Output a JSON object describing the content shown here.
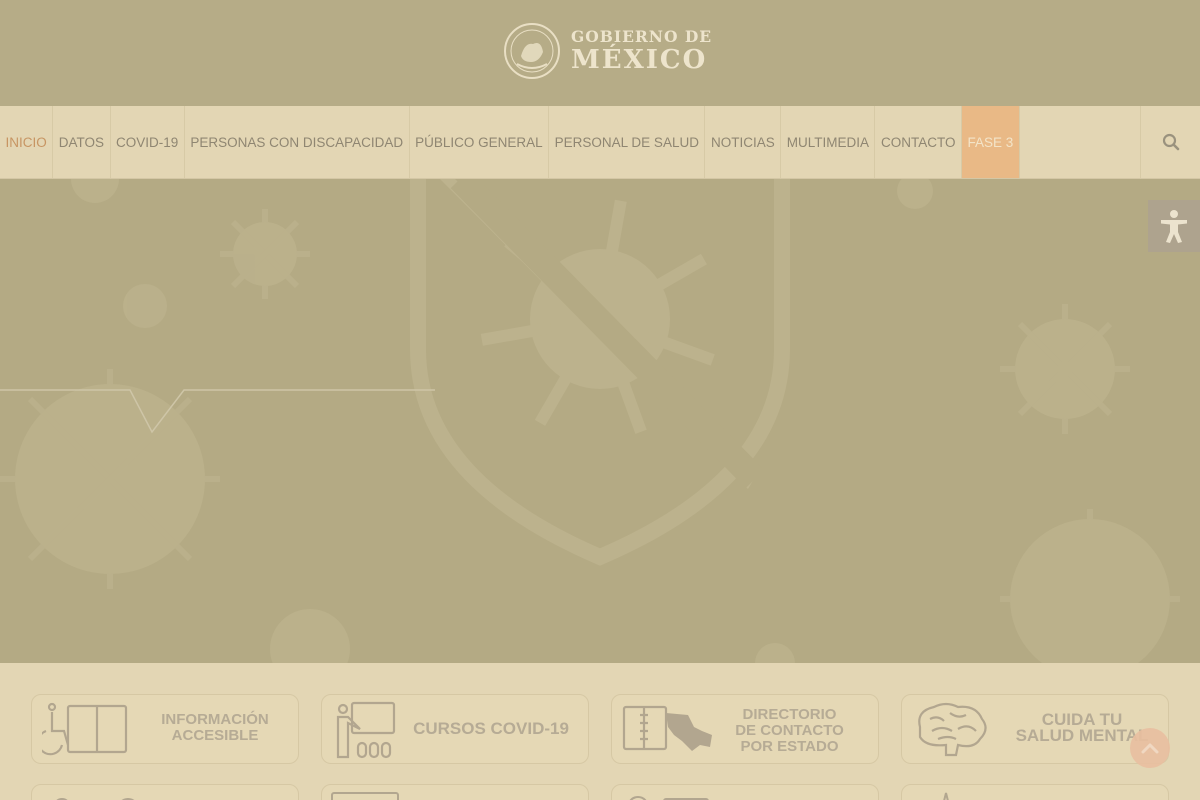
{
  "header": {
    "logo_line1": "GOBIERNO DE",
    "logo_line2": "MÉXICO"
  },
  "nav": {
    "items": [
      {
        "label": "INICIO"
      },
      {
        "label": "DATOS"
      },
      {
        "label": "COVID-19"
      },
      {
        "label": "PERSONAS CON DISCAPACIDAD"
      },
      {
        "label": "PÚBLICO GENERAL"
      },
      {
        "label": "PERSONAL DE SALUD"
      },
      {
        "label": "NOTICIAS"
      },
      {
        "label": "MULTIMEDIA"
      },
      {
        "label": "CONTACTO"
      },
      {
        "label": "FASE 3"
      }
    ],
    "search_icon": "search-icon"
  },
  "hero": {
    "image": "covid virus shield banner"
  },
  "accessibility": {
    "icon": "accessibility-icon"
  },
  "cards": [
    {
      "line1": "INFORMACIÓN",
      "line2": "ACCESIBLE",
      "line3": "",
      "icon": "accessible-info-icon"
    },
    {
      "line1": "CURSOS COVID-19",
      "line2": "",
      "line3": "",
      "icon": "course-teacher-icon"
    },
    {
      "line1": "DIRECTORIO",
      "line2": "DE CONTACTO",
      "line3": "POR ESTADO",
      "icon": "directory-map-icon"
    },
    {
      "line1": "CUIDA TU",
      "line2": "SALUD MENTAL",
      "line3": "",
      "icon": "brain-icon"
    }
  ],
  "colors": {
    "header_bg": "#b6ac87",
    "nav_bg": "#e3d6b4",
    "active_nav": "#c79563",
    "fase_bg": "#e9b986",
    "hero_bg": "#b4aa84"
  }
}
